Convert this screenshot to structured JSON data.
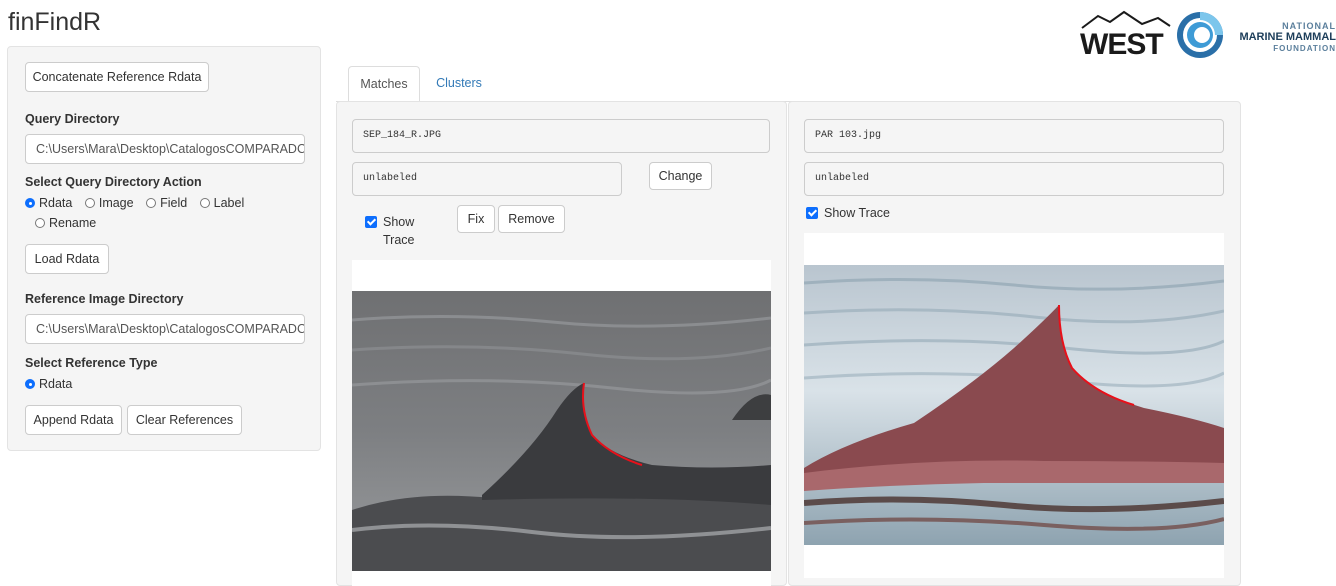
{
  "app": {
    "title": "finFindR"
  },
  "logos": {
    "west_text": "WEST",
    "nmmf_line1": "NATIONAL",
    "nmmf_line2": "MARINE MAMMAL",
    "nmmf_line3": "FOUNDATION"
  },
  "sidebar": {
    "concat_button": "Concatenate Reference Rdata",
    "query_dir_label": "Query Directory",
    "query_dir_value": "C:\\Users\\Mara\\Desktop\\CatalogosCOMPARADC",
    "query_action_label": "Select Query Directory Action",
    "query_actions": [
      {
        "label": "Rdata",
        "selected": true
      },
      {
        "label": "Image",
        "selected": false
      },
      {
        "label": "Field",
        "selected": false
      },
      {
        "label": "Label",
        "selected": false
      },
      {
        "label": "Rename",
        "selected": false
      }
    ],
    "load_button": "Load Rdata",
    "ref_dir_label": "Reference Image Directory",
    "ref_dir_value": "C:\\Users\\Mara\\Desktop\\CatalogosCOMPARADC",
    "ref_type_label": "Select Reference Type",
    "ref_types": [
      {
        "label": "Rdata",
        "selected": true
      }
    ],
    "append_button": "Append Rdata",
    "clear_button": "Clear References"
  },
  "tabs": [
    {
      "label": "Matches",
      "active": true
    },
    {
      "label": "Clusters",
      "active": false
    }
  ],
  "query_panel": {
    "filename": "SEP_184_R.JPG",
    "label_value": "unlabeled",
    "change_button": "Change",
    "show_trace_label": "Show Trace",
    "show_trace_checked": true,
    "fix_button": "Fix",
    "remove_button": "Remove"
  },
  "reference_panel": {
    "filename": "PAR 103.jpg",
    "label_value": "unlabeled",
    "show_trace_label": "Show Trace",
    "show_trace_checked": true
  },
  "colors": {
    "accent": "#0d6efd",
    "trace": "#e8101a",
    "link": "#337ab7"
  }
}
